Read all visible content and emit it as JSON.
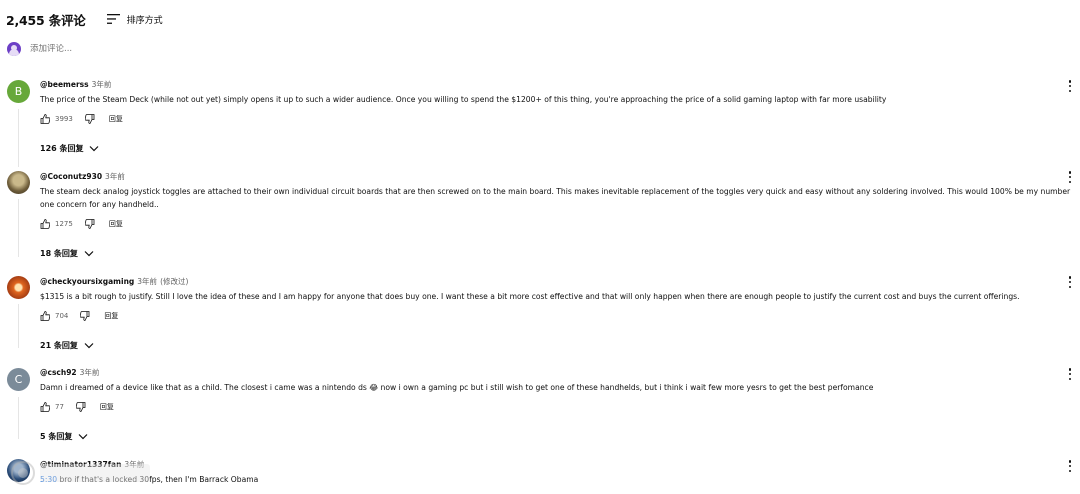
{
  "header": {
    "comment_count": "2,455 条评论",
    "sort_label": "排序方式"
  },
  "add_comment": {
    "placeholder": "添加评论..."
  },
  "comments": [
    {
      "avatar_letter": "B",
      "avatar_color": "#67a83a",
      "author": "@beemerss",
      "time": "3年前",
      "edited": "",
      "text": "The price of the Steam Deck (while not out yet) simply opens it up to such a wider audience. Once you willing to spend the $1200+ of this thing, you're approaching the price of a solid gaming laptop with far more usability",
      "likes": "3993",
      "reply_label": "回复",
      "replies": "126 条回复"
    },
    {
      "avatar_letter": "",
      "avatar_color": "#8a7a55",
      "author": "@Coconutz930",
      "time": "3年前",
      "edited": "",
      "text": "The steam deck analog joystick toggles are attached to their own individual circuit boards that are then screwed on to the main board. This makes inevitable replacement of the toggles very quick and easy without any soldering involved. This would 100% be my number one concern for any handheld..",
      "likes": "1275",
      "reply_label": "回复",
      "replies": "18 条回复"
    },
    {
      "avatar_letter": "",
      "avatar_color": "#b8401f",
      "author": "@checkyoursixgaming",
      "time": "3年前",
      "edited": "(修改过)",
      "text": "$1315 is a bit rough to justify. Still I love the idea of these and I am happy for anyone that does buy one. I want these a bit more cost effective and that will only happen when there are enough people to justify the current cost and buys the current offerings.",
      "likes": "704",
      "reply_label": "回复",
      "replies": "21 条回复"
    },
    {
      "avatar_letter": "C",
      "avatar_color": "#7b8b99",
      "author": "@csch92",
      "time": "3年前",
      "edited": "",
      "text": "Damn i dreamed of a device like that as a child. The closest i came was a nintendo ds 😂 now i own a gaming pc but i still wish to get one of these handhelds, but i think i wait few more yesrs to get the best perfomance",
      "likes": "77",
      "reply_label": "回复",
      "replies": "5 条回复"
    },
    {
      "avatar_letter": "",
      "avatar_color": "#2a4c78",
      "author": "@timinator1337fan",
      "time": "3年前",
      "edited": "",
      "timestamp": "5:30",
      "text": "bro if that's a locked 30fps, then I'm Barrack Obama"
    }
  ]
}
